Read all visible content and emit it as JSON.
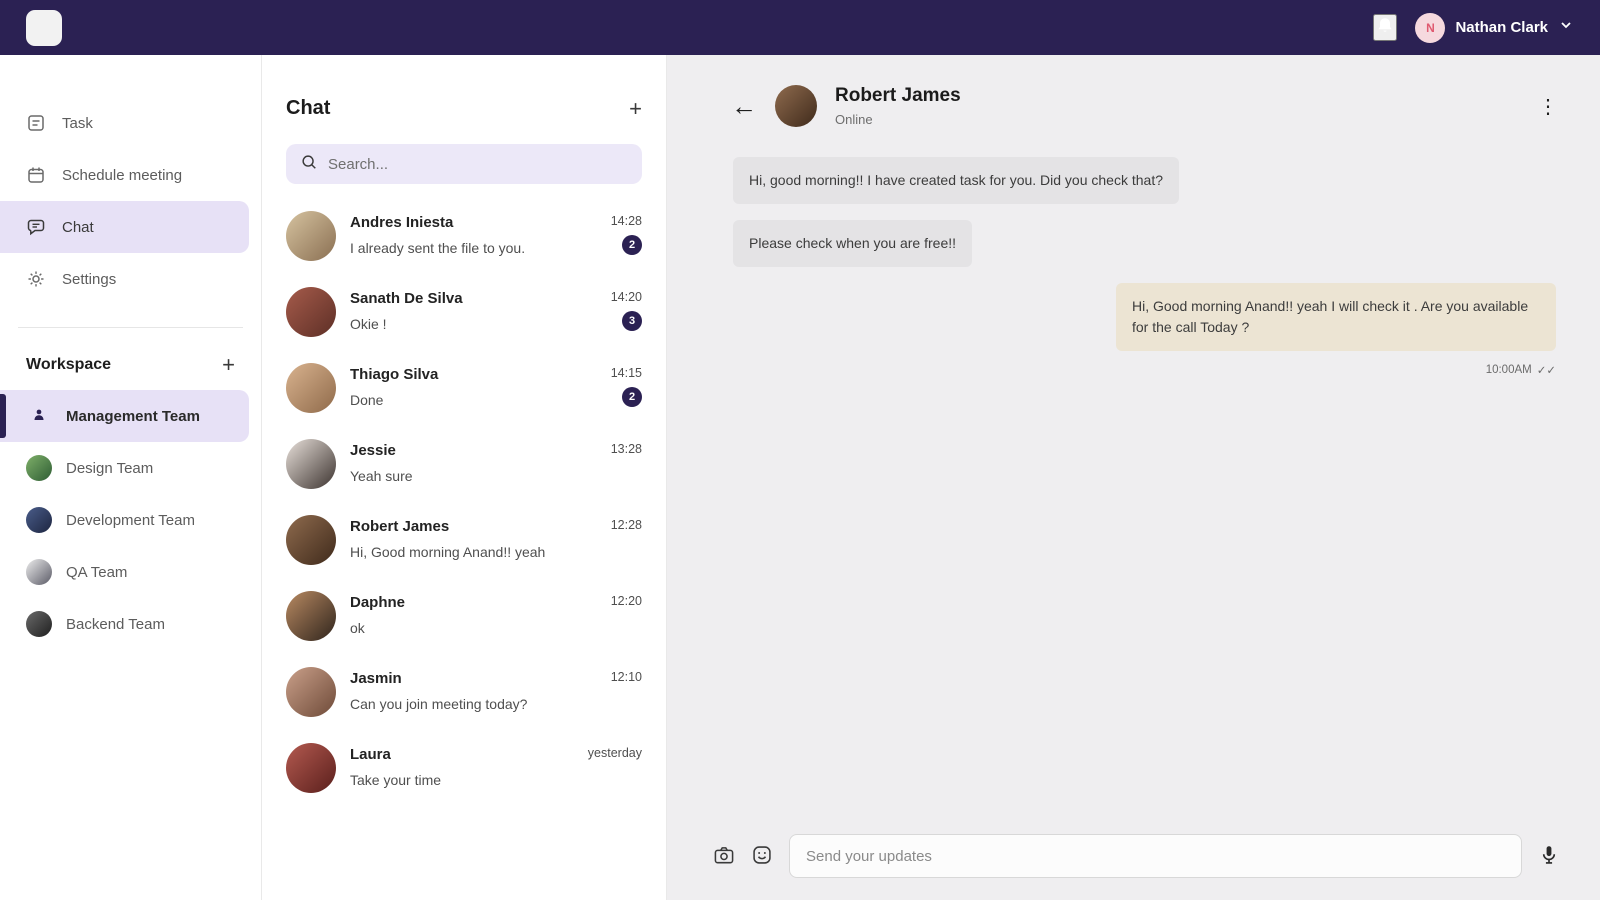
{
  "topbar": {
    "user_initial": "N",
    "user_name": "Nathan Clark"
  },
  "sidebar": {
    "menu": [
      {
        "label": "Task"
      },
      {
        "label": "Schedule meeting"
      },
      {
        "label": "Chat"
      },
      {
        "label": "Settings"
      }
    ],
    "workspace_title": "Workspace",
    "add_workspace_label": "+",
    "workspaces": [
      {
        "label": "Management Team"
      },
      {
        "label": "Design Team"
      },
      {
        "label": "Development Team"
      },
      {
        "label": "QA Team"
      },
      {
        "label": "Backend Team"
      }
    ]
  },
  "chat_list": {
    "title": "Chat",
    "new_chat_label": "+",
    "search_placeholder": "Search...",
    "items": [
      {
        "name": "Andres Iniesta",
        "preview": "I already sent the file to you.",
        "time": "14:28",
        "badge": "2"
      },
      {
        "name": "Sanath De Silva",
        "preview": "Okie !",
        "time": "14:20",
        "badge": "3"
      },
      {
        "name": "Thiago Silva",
        "preview": "Done",
        "time": "14:15",
        "badge": "2"
      },
      {
        "name": "Jessie",
        "preview": "Yeah sure",
        "time": "13:28",
        "badge": ""
      },
      {
        "name": "Robert James",
        "preview": "Hi, Good morning Anand!! yeah",
        "time": "12:28",
        "badge": ""
      },
      {
        "name": "Daphne",
        "preview": "ok",
        "time": "12:20",
        "badge": ""
      },
      {
        "name": "Jasmin",
        "preview": "Can you join meeting today?",
        "time": "12:10",
        "badge": ""
      },
      {
        "name": "Laura",
        "preview": "Take your time",
        "time": "yesterday",
        "badge": ""
      }
    ]
  },
  "conversation": {
    "back_label": "←",
    "kebab_label": "⋮",
    "peer_name": "Robert James",
    "peer_status": "Online",
    "messages": [
      {
        "side": "left",
        "text": "Hi, good morning!! I have created task for you. Did you check that?"
      },
      {
        "side": "left",
        "text": "Please check when you are free!!"
      },
      {
        "side": "right",
        "text": "Hi, Good morning Anand!! yeah I will check it . Are you available for the call Today ?"
      }
    ],
    "sent_time": "10:00AM",
    "read_ticks": "✓✓",
    "composer_placeholder": "Send your updates"
  },
  "colors": {
    "brand": "#2b2153",
    "highlight": "#e7e1f6",
    "bubble_left": "#e4e3e5",
    "bubble_right": "#ece4d3",
    "pane_bg": "#efeef0"
  }
}
